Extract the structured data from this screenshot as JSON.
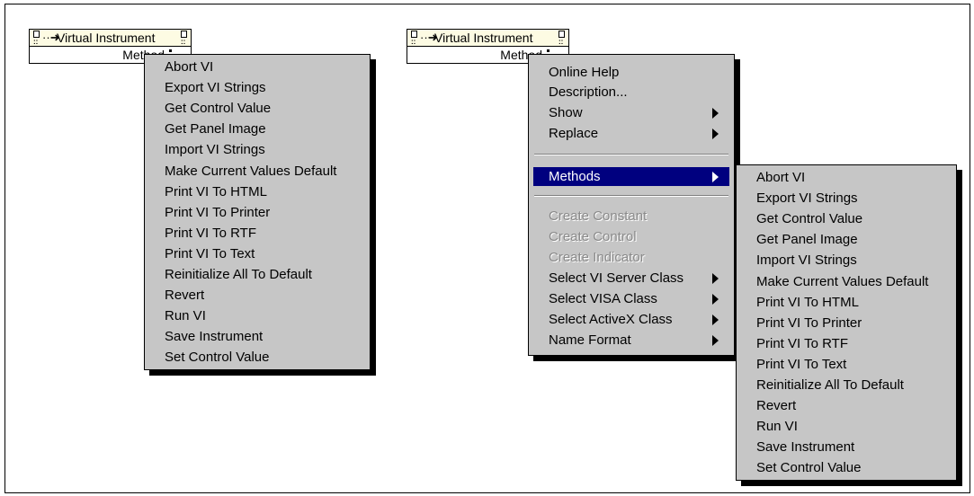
{
  "left_node": {
    "title": "Virtual Instrument",
    "method": "Method"
  },
  "right_node": {
    "title": "Virtual Instrument",
    "method": "Method"
  },
  "methods_list": [
    "Abort VI",
    "Export VI Strings",
    "Get Control Value",
    "Get Panel Image",
    "Import VI Strings",
    "Make Current Values Default",
    "Print VI To HTML",
    "Print VI To Printer",
    "Print VI To RTF",
    "Print VI To Text",
    "Reinitialize All To Default",
    "Revert",
    "Run VI",
    "Save Instrument",
    "Set Control Value"
  ],
  "context_menu": {
    "group1": [
      {
        "label": "Online Help",
        "submenu": false
      },
      {
        "label": "Description...",
        "submenu": false
      },
      {
        "label": "Show",
        "submenu": true
      },
      {
        "label": "Replace",
        "submenu": true
      }
    ],
    "methods": {
      "label": "Methods",
      "submenu": true
    },
    "group2_disabled": [
      "Create Constant",
      "Create Control",
      "Create Indicator"
    ],
    "group3": [
      {
        "label": "Select VI Server Class",
        "submenu": true
      },
      {
        "label": "Select VISA Class",
        "submenu": true
      },
      {
        "label": "Select ActiveX Class",
        "submenu": true
      },
      {
        "label": "Name Format",
        "submenu": true
      }
    ]
  },
  "colors": {
    "menu_bg": "#c6c6c6",
    "highlight_bg": "#00007f",
    "node_header_bg": "#fdfbe3",
    "disabled_text": "#8a8a8a"
  }
}
